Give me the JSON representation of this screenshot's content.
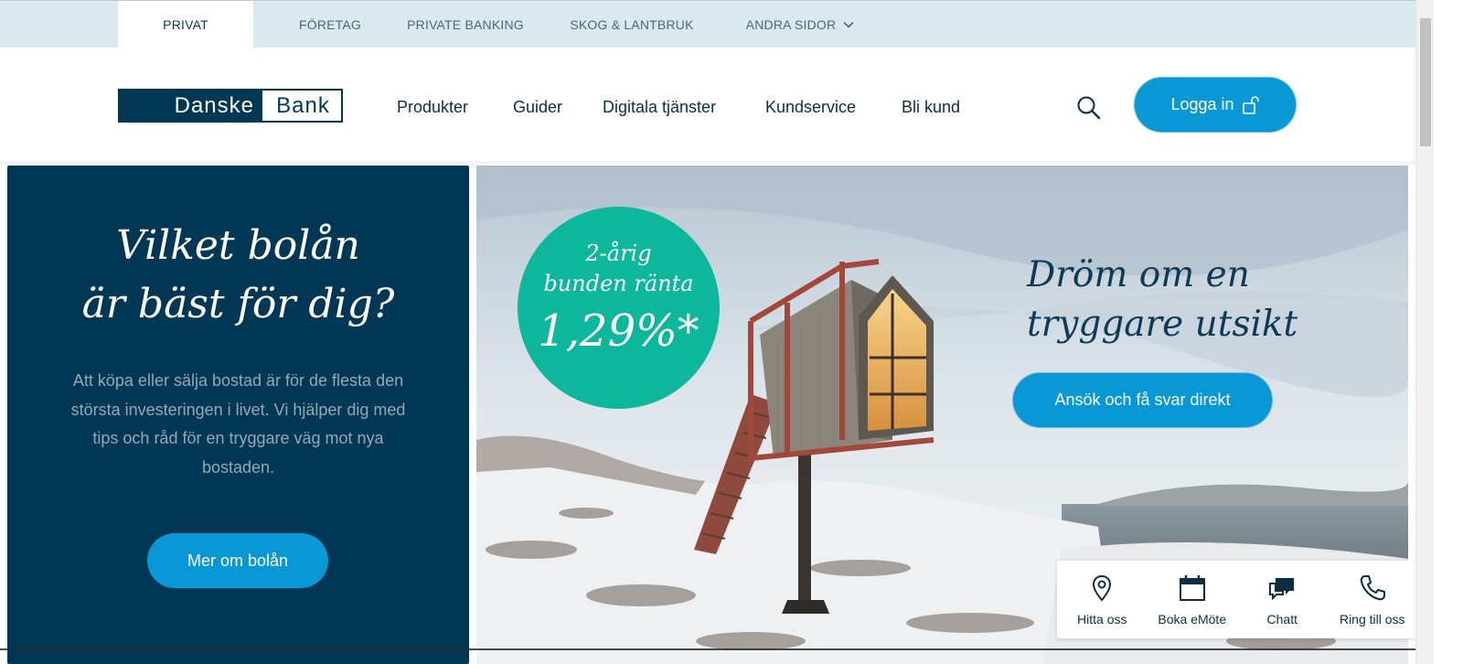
{
  "segments": [
    {
      "label": "PRIVAT",
      "active": true
    },
    {
      "label": "FÖRETAG"
    },
    {
      "label": "PRIVATE BANKING"
    },
    {
      "label": "SKOG & LANTBRUK"
    },
    {
      "label": "ANDRA SIDOR"
    }
  ],
  "logo": {
    "part1": "Danske",
    "part2": "Bank",
    "color": "#003755"
  },
  "nav": [
    "Produkter",
    "Guider",
    "Digitala tjänster",
    "Kundservice",
    "Bli kund"
  ],
  "login": {
    "label": "Logga in",
    "icon": "unlock-icon"
  },
  "promo": {
    "title_line1": "Vilket bolån",
    "title_line2": "är bäst för dig?",
    "text": "Att köpa eller sälja bostad är för de flesta den största investeringen i livet. Vi hjälper dig med tips och råd för en tryggare väg mot nya bostaden.",
    "button": "Mer om bolån"
  },
  "hero": {
    "badge_line1": "2-årig",
    "badge_line2": "bunden ränta",
    "badge_rate": "1,29%*",
    "title_line1": "Dröm om en",
    "title_line2": "tryggare utsikt",
    "button": "Ansök och få svar direkt"
  },
  "quick": [
    {
      "label": "Hitta oss",
      "icon": "map-pin-icon"
    },
    {
      "label": "Boka eMöte",
      "icon": "calendar-icon"
    },
    {
      "label": "Chatt",
      "icon": "chat-icon"
    },
    {
      "label": "Ring till oss",
      "icon": "phone-icon"
    }
  ],
  "colors": {
    "navy": "#003755",
    "accent_blue": "#0a97d6",
    "teal": "#0db79b",
    "segbar": "#d9e9ef"
  }
}
